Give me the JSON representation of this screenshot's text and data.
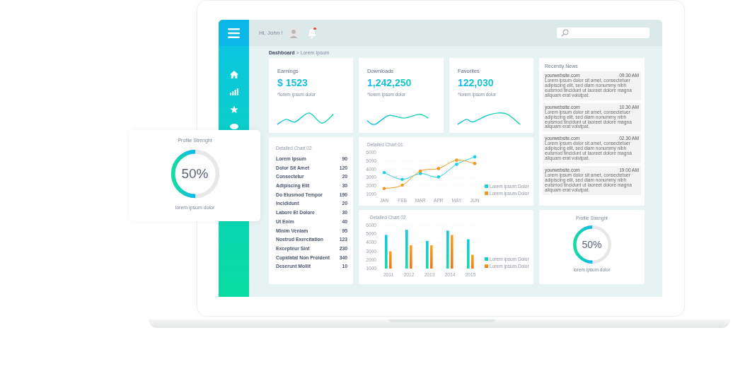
{
  "header": {
    "greeting": "Hi, John !",
    "notification": true
  },
  "breadcrumb": "**Dashboard** > Lorem Ipsum",
  "stats": [
    {
      "title": "Earnings",
      "value": "$ 1523",
      "note": "*lorem ipsum dolor"
    },
    {
      "title": "Downloads",
      "value": "1,242,250",
      "note": "*lorem ipsum dolor"
    },
    {
      "title": "Favorites",
      "value": "122,030",
      "note": "*lorem ipsum dolor"
    }
  ],
  "news": {
    "title": "Recently News",
    "items": [
      {
        "source": "yourwebsite.com",
        "time": "09.30 AM",
        "text": "Lorem ipsum dolor sit amet, consectetuer adipiscing elit, sed diam nonummy nibh euismod tincidunt ut laoreet dolore magna aliquam erat volutpat."
      },
      {
        "source": "yourwebsite.com",
        "time": "10.30 AM",
        "text": "Lorem ipsum dolor sit amet, consectetuer adipiscing elit, sed diam nonummy nibh euismod tincidunt ut laoreet dolore magna aliquam erat volutpat."
      },
      {
        "source": "yourwebsite.com",
        "time": "02.30 AM",
        "text": "Lorem ipsum dolor sit amet, consectetuer adipiscing elit, sed diam nonummy nibh euismod tincidunt ut laoreet dolore magna aliquam erat volutpat."
      },
      {
        "source": "yourwebsite.com",
        "time": "19.00 AM",
        "text": "Lorem ipsum dolor sit amet, consectetuer adipiscing elit, sed diam nonummy nibh euismod tincidunt ut laoreet dolore magna aliquam erat volutpat."
      }
    ]
  },
  "list": {
    "title": "Detailed Chart 02",
    "rows": [
      {
        "label": "Lorem Ipsum",
        "value": "90"
      },
      {
        "label": "Dolor Sit Amet",
        "value": "120"
      },
      {
        "label": "Consectetur",
        "value": "20"
      },
      {
        "label": "Adipiscing Elit",
        "value": "30"
      },
      {
        "label": "Do Eiusmod Tempor",
        "value": "190"
      },
      {
        "label": "Incididunt",
        "value": "20"
      },
      {
        "label": "Labore Et Dolore",
        "value": "30"
      },
      {
        "label": "Ut Enim",
        "value": "40"
      },
      {
        "label": "Minim Veniam",
        "value": "95"
      },
      {
        "label": "Nostrud Exercitation",
        "value": "123"
      },
      {
        "label": "Excepteur Sint",
        "value": "230"
      },
      {
        "label": "Cupidatat Non Proident",
        "value": "340"
      },
      {
        "label": "Deserunt Mollit",
        "value": "10"
      }
    ]
  },
  "line_chart": {
    "chart_data": {
      "type": "line",
      "title": "Detailed Chart 01",
      "categories": [
        "JAN",
        "FEB",
        "MAR",
        "APR",
        "MAY",
        "JUN"
      ],
      "ylim": [
        1000,
        6000
      ],
      "yticks": [
        1000,
        2000,
        3000,
        4000,
        5000,
        6000
      ],
      "grid": true,
      "series": [
        {
          "name": "Lorem ipsum Dolor",
          "color": "#1ccfe0",
          "values": [
            3600,
            2800,
            3500,
            3100,
            4600,
            5500
          ]
        },
        {
          "name": "Lorem ipsum Dolor",
          "color": "#f39a1e",
          "values": [
            1700,
            2100,
            3800,
            4100,
            5100,
            4700
          ]
        }
      ]
    }
  },
  "bar_chart": {
    "chart_data": {
      "type": "bar",
      "title": "Detailed Chart 02",
      "categories": [
        "2011",
        "2012",
        "2013",
        "2014",
        "2015"
      ],
      "ylim": [
        1000,
        6000
      ],
      "yticks": [
        1000,
        2000,
        3000,
        4000,
        5000,
        6000
      ],
      "grid": true,
      "series": [
        {
          "name": "Lorem ipsum Dolor",
          "color": "#12c6e6",
          "values": [
            4900,
            5500,
            4200,
            5400,
            4400
          ]
        },
        {
          "name": "Lorem ipsum Dolor",
          "color": "#f7a21b",
          "values": [
            3000,
            3700,
            3700,
            4900,
            2600
          ]
        }
      ]
    }
  },
  "profile": {
    "title": "Profile Strenght",
    "level": 0.5,
    "reading": "50%",
    "caption": "lorem ipsum dolor"
  },
  "floating_profile": {
    "title": "Profile Strenght",
    "level": 0.5,
    "reading": "50%",
    "caption": "lorem ipsum dolor"
  }
}
